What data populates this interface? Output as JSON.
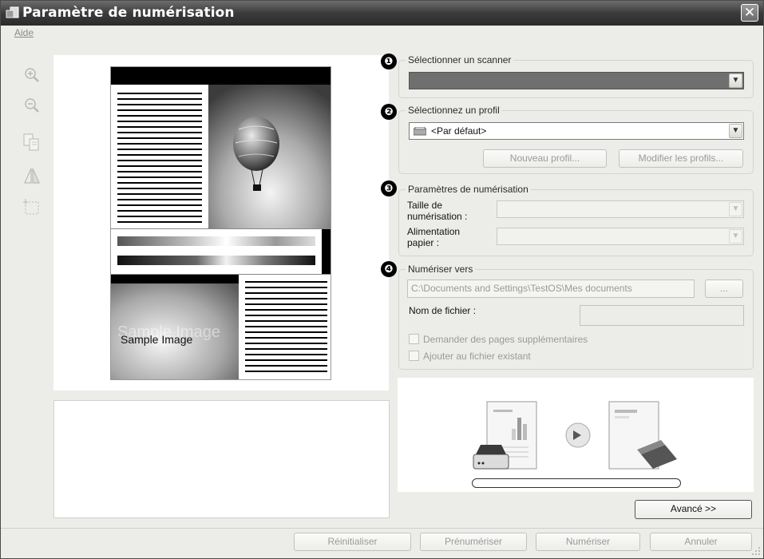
{
  "window": {
    "title": "Paramètre de numérisation"
  },
  "menu": {
    "aide": "Aide"
  },
  "tools": [
    "zoom-in-icon",
    "zoom-out-icon",
    "copy-page-icon",
    "mirror-icon",
    "crop-select-icon"
  ],
  "preview": {
    "sample_text": "Sample Image",
    "sample_watermark": "Sample Image"
  },
  "steps": {
    "one": "❶",
    "two": "❷",
    "three": "❸",
    "four": "❹"
  },
  "scanner": {
    "legend": "Sélectionner un scanner",
    "value": ""
  },
  "profile": {
    "legend": "Sélectionnez un profil",
    "value": "<Par défaut>",
    "new_button": "Nouveau profil...",
    "edit_button": "Modifier les profils..."
  },
  "scan_params": {
    "legend": "Paramètres de numérisation",
    "size_label_1": "Taille de",
    "size_label_2": "numérisation :",
    "feed_label_1": "Alimentation",
    "feed_label_2": "papier :"
  },
  "scan_to": {
    "legend": "Numériser vers",
    "path": "C:\\Documents and Settings\\TestOS\\Mes documents",
    "browse_button": "...",
    "filename_label": "Nom de fichier :",
    "filename_value": "",
    "check_more_pages": "Demander des pages supplémentaires",
    "check_append": "Ajouter au fichier existant"
  },
  "advanced_button": "Avancé >>",
  "footer": {
    "reset": "Réinitialiser",
    "prescan": "Prénumériser",
    "scan": "Numériser",
    "cancel": "Annuler"
  },
  "colors": {
    "window_bg": "#ecece8",
    "titlebar": "#3b3b3b",
    "group_border": "#d3d3cf",
    "disabled_text": "#9a9a98",
    "scanner_field": "#6f6f6f"
  }
}
